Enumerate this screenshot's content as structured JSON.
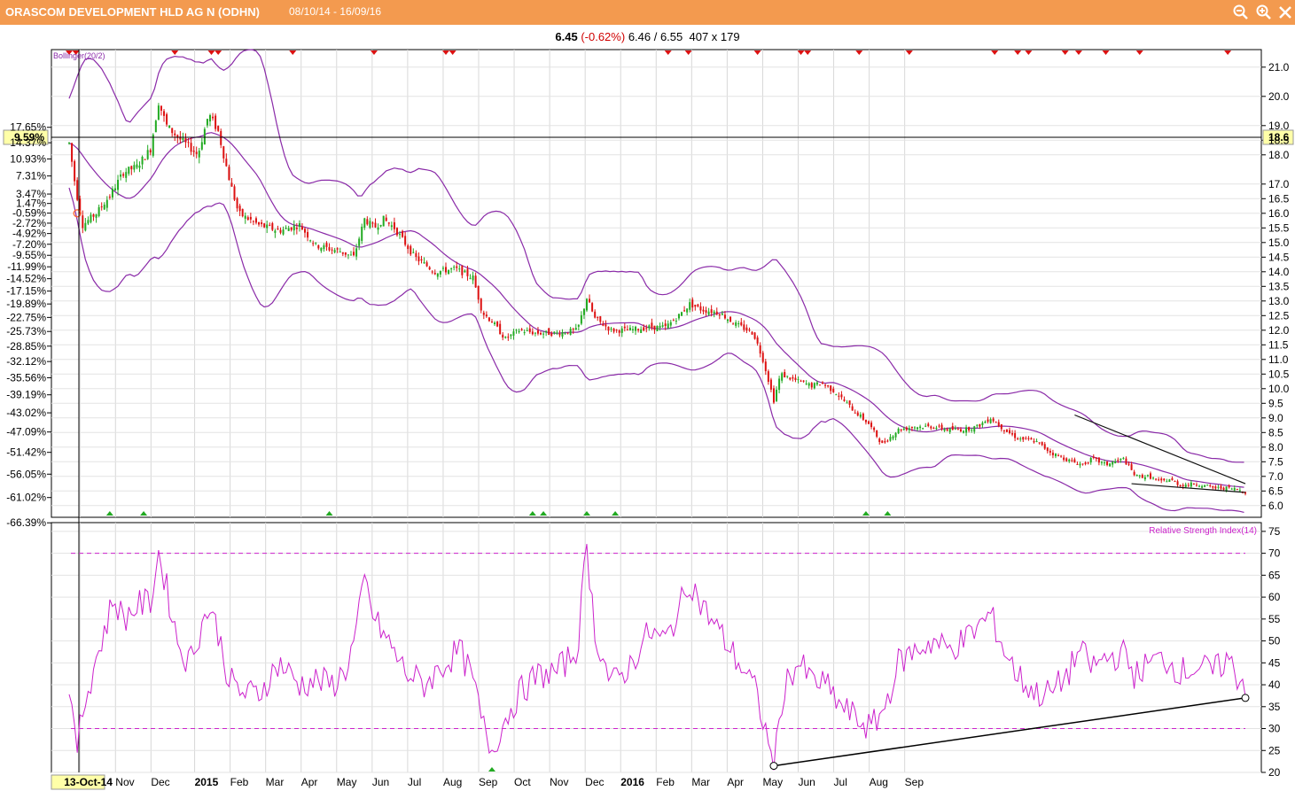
{
  "window": {
    "title": "ORASCOM DEVELOPMENT HLD AG N (ODHN)",
    "date_range": "08/10/14 - 16/09/16",
    "icons": [
      "zoom-out-icon",
      "zoom-in-icon",
      "close-icon"
    ]
  },
  "quote": {
    "last": "6.45",
    "change": "(-0.62%)",
    "low_high": "6.46 / 6.55",
    "counts": "407 x 179"
  },
  "colors": {
    "up": "#22aa22",
    "down": "#dd1111",
    "bollinger": "#8a2aa8",
    "rsi": "#cc22cc",
    "title_bar": "#f39a4f"
  },
  "chart_data": [
    {
      "type": "candlestick",
      "indicator_label": "Bollinger(20/2)",
      "y_right_ticks": [
        "6.0",
        "6.5",
        "7.0",
        "7.5",
        "8.0",
        "8.5",
        "9.0",
        "9.5",
        "10.0",
        "10.5",
        "11.0",
        "11.5",
        "12.0",
        "12.5",
        "13.0",
        "13.5",
        "14.0",
        "14.5",
        "15.0",
        "15.5",
        "16.0",
        "16.5",
        "17.0",
        "18.0",
        "18.5",
        "19.0",
        "20.0",
        "21.0"
      ],
      "y_left_ticks": [
        "17.65%",
        "14.37%",
        "10.93%",
        "7.31%",
        "3.47%",
        "1.47%",
        "-0.59%",
        "-2.72%",
        "-4.92%",
        "-7.20%",
        "-9.55%",
        "-11.99%",
        "-14.52%",
        "-17.15%",
        "-19.89%",
        "-22.75%",
        "-25.73%",
        "-28.85%",
        "-32.12%",
        "-35.56%",
        "-39.19%",
        "-43.02%",
        "-47.09%",
        "-51.42%",
        "-56.05%",
        "-61.02%",
        "-66.39%"
      ],
      "crosshair_left_label": "9.59%",
      "crosshair_right_label": "18.6",
      "crosshair_value": 18.6,
      "x_labels": [
        "13-Oct-14",
        "Nov",
        "Dec",
        "2015",
        "Feb",
        "Mar",
        "Apr",
        "May",
        "Jun",
        "Jul",
        "Aug",
        "Sep",
        "Oct",
        "Nov",
        "Dec",
        "2016",
        "Feb",
        "Mar",
        "Apr",
        "May",
        "Jun",
        "Jul",
        "Aug",
        "Sep"
      ],
      "ylim": [
        5.6,
        21.6
      ],
      "price_path": [
        {
          "d": 0,
          "v": 18.4
        },
        {
          "d": 5,
          "v": 16.8
        },
        {
          "d": 10,
          "v": 15.6
        },
        {
          "d": 20,
          "v": 16.0
        },
        {
          "d": 30,
          "v": 16.6
        },
        {
          "d": 40,
          "v": 17.4
        },
        {
          "d": 50,
          "v": 17.6
        },
        {
          "d": 60,
          "v": 18.2
        },
        {
          "d": 66,
          "v": 19.8
        },
        {
          "d": 72,
          "v": 19.0
        },
        {
          "d": 80,
          "v": 18.6
        },
        {
          "d": 88,
          "v": 18.3
        },
        {
          "d": 95,
          "v": 18.0
        },
        {
          "d": 103,
          "v": 19.4
        },
        {
          "d": 110,
          "v": 18.8
        },
        {
          "d": 118,
          "v": 17.2
        },
        {
          "d": 125,
          "v": 16.0
        },
        {
          "d": 140,
          "v": 15.6
        },
        {
          "d": 155,
          "v": 15.4
        },
        {
          "d": 170,
          "v": 15.6
        },
        {
          "d": 182,
          "v": 14.9
        },
        {
          "d": 200,
          "v": 14.7
        },
        {
          "d": 210,
          "v": 14.5
        },
        {
          "d": 218,
          "v": 15.8
        },
        {
          "d": 225,
          "v": 15.5
        },
        {
          "d": 232,
          "v": 15.8
        },
        {
          "d": 240,
          "v": 15.5
        },
        {
          "d": 255,
          "v": 14.5
        },
        {
          "d": 270,
          "v": 14.0
        },
        {
          "d": 285,
          "v": 14.1
        },
        {
          "d": 298,
          "v": 13.8
        },
        {
          "d": 305,
          "v": 12.6
        },
        {
          "d": 312,
          "v": 12.3
        },
        {
          "d": 322,
          "v": 11.7
        },
        {
          "d": 332,
          "v": 12.0
        },
        {
          "d": 345,
          "v": 11.9
        },
        {
          "d": 360,
          "v": 11.9
        },
        {
          "d": 375,
          "v": 12.0
        },
        {
          "d": 382,
          "v": 13.1
        },
        {
          "d": 388,
          "v": 12.4
        },
        {
          "d": 400,
          "v": 12.0
        },
        {
          "d": 413,
          "v": 12.0
        },
        {
          "d": 428,
          "v": 12.1
        },
        {
          "d": 440,
          "v": 12.1
        },
        {
          "d": 450,
          "v": 12.5
        },
        {
          "d": 458,
          "v": 12.9
        },
        {
          "d": 467,
          "v": 12.7
        },
        {
          "d": 480,
          "v": 12.6
        },
        {
          "d": 492,
          "v": 12.2
        },
        {
          "d": 505,
          "v": 11.9
        },
        {
          "d": 512,
          "v": 11.0
        },
        {
          "d": 520,
          "v": 9.6
        },
        {
          "d": 525,
          "v": 10.5
        },
        {
          "d": 535,
          "v": 10.3
        },
        {
          "d": 548,
          "v": 10.1
        },
        {
          "d": 555,
          "v": 10.2
        },
        {
          "d": 565,
          "v": 9.9
        },
        {
          "d": 578,
          "v": 9.3
        },
        {
          "d": 590,
          "v": 8.8
        },
        {
          "d": 600,
          "v": 8.1
        },
        {
          "d": 612,
          "v": 8.6
        },
        {
          "d": 625,
          "v": 8.7
        },
        {
          "d": 638,
          "v": 8.7
        },
        {
          "d": 648,
          "v": 8.6
        },
        {
          "d": 660,
          "v": 8.6
        },
        {
          "d": 670,
          "v": 8.7
        },
        {
          "d": 680,
          "v": 9.0
        },
        {
          "d": 690,
          "v": 8.6
        },
        {
          "d": 700,
          "v": 8.3
        },
        {
          "d": 713,
          "v": 8.2
        },
        {
          "d": 725,
          "v": 7.8
        },
        {
          "d": 740,
          "v": 7.5
        },
        {
          "d": 748,
          "v": 7.4
        },
        {
          "d": 755,
          "v": 7.6
        },
        {
          "d": 765,
          "v": 7.4
        },
        {
          "d": 778,
          "v": 7.6
        },
        {
          "d": 787,
          "v": 7.0
        },
        {
          "d": 797,
          "v": 7.0
        },
        {
          "d": 805,
          "v": 6.8
        },
        {
          "d": 812,
          "v": 6.9
        },
        {
          "d": 820,
          "v": 6.7
        },
        {
          "d": 832,
          "v": 6.75
        },
        {
          "d": 845,
          "v": 6.6
        },
        {
          "d": 855,
          "v": 6.6
        },
        {
          "d": 863,
          "v": 6.55
        },
        {
          "d": 868,
          "v": 6.45
        }
      ],
      "trendlines": [
        {
          "from": {
            "d": 742,
            "v": 9.1
          },
          "to": {
            "d": 868,
            "v": 6.75
          }
        },
        {
          "from": {
            "d": 784,
            "v": 6.75
          },
          "to": {
            "d": 868,
            "v": 6.45
          }
        }
      ],
      "sell_signal_days": [
        0,
        5,
        78,
        105,
        110,
        165,
        225,
        278,
        283,
        442,
        457,
        508,
        540,
        545,
        583,
        620,
        683,
        700,
        708,
        735,
        745,
        765,
        790,
        855
      ],
      "buy_signal_days": [
        30,
        55,
        192,
        342,
        350,
        382,
        403,
        588,
        604
      ]
    },
    {
      "type": "line",
      "indicator_label": "Relative Strength Index(14)",
      "y_ticks": [
        "20",
        "25",
        "30",
        "35",
        "40",
        "45",
        "50",
        "55",
        "60",
        "65",
        "70",
        "75"
      ],
      "ylim": [
        20,
        77
      ],
      "overbought": 70,
      "oversold": 30,
      "rsi_path": [
        {
          "d": 0,
          "v": 41
        },
        {
          "d": 5,
          "v": 24
        },
        {
          "d": 10,
          "v": 34
        },
        {
          "d": 18,
          "v": 44
        },
        {
          "d": 26,
          "v": 52
        },
        {
          "d": 33,
          "v": 60
        },
        {
          "d": 40,
          "v": 55
        },
        {
          "d": 50,
          "v": 58
        },
        {
          "d": 60,
          "v": 59
        },
        {
          "d": 66,
          "v": 70
        },
        {
          "d": 72,
          "v": 62
        },
        {
          "d": 80,
          "v": 50
        },
        {
          "d": 88,
          "v": 45
        },
        {
          "d": 95,
          "v": 51
        },
        {
          "d": 103,
          "v": 58
        },
        {
          "d": 110,
          "v": 52
        },
        {
          "d": 118,
          "v": 41
        },
        {
          "d": 128,
          "v": 38
        },
        {
          "d": 140,
          "v": 38
        },
        {
          "d": 155,
          "v": 45
        },
        {
          "d": 170,
          "v": 40
        },
        {
          "d": 182,
          "v": 41
        },
        {
          "d": 195,
          "v": 40
        },
        {
          "d": 205,
          "v": 44
        },
        {
          "d": 212,
          "v": 52
        },
        {
          "d": 218,
          "v": 64
        },
        {
          "d": 225,
          "v": 55
        },
        {
          "d": 235,
          "v": 50
        },
        {
          "d": 248,
          "v": 43
        },
        {
          "d": 262,
          "v": 40
        },
        {
          "d": 275,
          "v": 44
        },
        {
          "d": 288,
          "v": 48
        },
        {
          "d": 298,
          "v": 41
        },
        {
          "d": 305,
          "v": 31
        },
        {
          "d": 312,
          "v": 25
        },
        {
          "d": 320,
          "v": 31
        },
        {
          "d": 332,
          "v": 38
        },
        {
          "d": 345,
          "v": 42
        },
        {
          "d": 360,
          "v": 43
        },
        {
          "d": 375,
          "v": 48
        },
        {
          "d": 382,
          "v": 72
        },
        {
          "d": 388,
          "v": 52
        },
        {
          "d": 400,
          "v": 40
        },
        {
          "d": 413,
          "v": 44
        },
        {
          "d": 428,
          "v": 52
        },
        {
          "d": 440,
          "v": 50
        },
        {
          "d": 450,
          "v": 57
        },
        {
          "d": 458,
          "v": 64
        },
        {
          "d": 467,
          "v": 58
        },
        {
          "d": 480,
          "v": 52
        },
        {
          "d": 492,
          "v": 46
        },
        {
          "d": 505,
          "v": 40
        },
        {
          "d": 512,
          "v": 32
        },
        {
          "d": 520,
          "v": 21
        },
        {
          "d": 528,
          "v": 40
        },
        {
          "d": 538,
          "v": 45
        },
        {
          "d": 548,
          "v": 41
        },
        {
          "d": 558,
          "v": 40
        },
        {
          "d": 570,
          "v": 35
        },
        {
          "d": 582,
          "v": 32
        },
        {
          "d": 592,
          "v": 30
        },
        {
          "d": 602,
          "v": 35
        },
        {
          "d": 612,
          "v": 45
        },
        {
          "d": 625,
          "v": 48
        },
        {
          "d": 638,
          "v": 50
        },
        {
          "d": 648,
          "v": 48
        },
        {
          "d": 660,
          "v": 50
        },
        {
          "d": 670,
          "v": 53
        },
        {
          "d": 680,
          "v": 56
        },
        {
          "d": 690,
          "v": 48
        },
        {
          "d": 700,
          "v": 42
        },
        {
          "d": 713,
          "v": 38
        },
        {
          "d": 725,
          "v": 38
        },
        {
          "d": 738,
          "v": 43
        },
        {
          "d": 745,
          "v": 48
        },
        {
          "d": 755,
          "v": 44
        },
        {
          "d": 765,
          "v": 46
        },
        {
          "d": 778,
          "v": 47
        },
        {
          "d": 787,
          "v": 42
        },
        {
          "d": 797,
          "v": 45
        },
        {
          "d": 808,
          "v": 46
        },
        {
          "d": 820,
          "v": 43
        },
        {
          "d": 832,
          "v": 44
        },
        {
          "d": 845,
          "v": 43
        },
        {
          "d": 855,
          "v": 46
        },
        {
          "d": 862,
          "v": 42
        },
        {
          "d": 868,
          "v": 40
        }
      ],
      "trendline": {
        "from": {
          "d": 520,
          "v": 21.5
        },
        "to": {
          "d": 868,
          "v": 37
        }
      },
      "buy_signal_days": [
        312
      ]
    }
  ]
}
